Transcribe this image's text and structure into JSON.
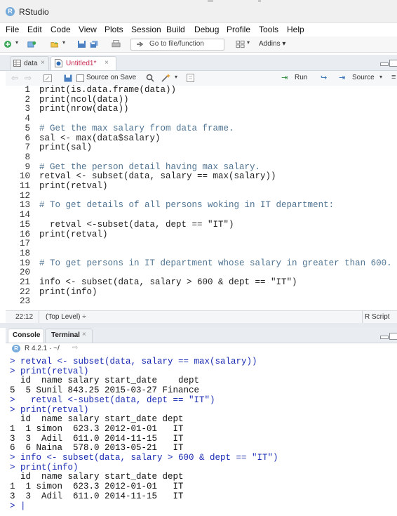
{
  "app": {
    "title": "RStudio",
    "icon_letter": "R"
  },
  "menu": [
    "File",
    "Edit",
    "Code",
    "View",
    "Plots",
    "Session",
    "Build",
    "Debug",
    "Profile",
    "Tools",
    "Help"
  ],
  "toolbar": {
    "goto_placeholder": "Go to file/function",
    "addins_label": "Addins"
  },
  "editor_tabs": [
    {
      "label": "data",
      "close": "×"
    },
    {
      "label": "Untitled1*",
      "close": "×"
    }
  ],
  "editor_toolbar": {
    "source_on_save": "Source on Save",
    "run_label": "Run",
    "source_label": "Source"
  },
  "code_lines": [
    {
      "n": "1",
      "text": "print(is.data.frame(data))",
      "kind": "code"
    },
    {
      "n": "2",
      "text": "print(ncol(data))",
      "kind": "code"
    },
    {
      "n": "3",
      "text": "print(nrow(data))",
      "kind": "code"
    },
    {
      "n": "4",
      "text": "",
      "kind": "code"
    },
    {
      "n": "5",
      "text": "# Get the max salary from data frame.",
      "kind": "comment"
    },
    {
      "n": "6",
      "text": "sal <- max(data$salary)",
      "kind": "code"
    },
    {
      "n": "7",
      "text": "print(sal)",
      "kind": "code"
    },
    {
      "n": "8",
      "text": "",
      "kind": "code"
    },
    {
      "n": "9",
      "text": "# Get the person detail having max salary.",
      "kind": "comment"
    },
    {
      "n": "10",
      "text": "retval <- subset(data, salary == max(salary))",
      "kind": "code"
    },
    {
      "n": "11",
      "text": "print(retval)",
      "kind": "code"
    },
    {
      "n": "12",
      "text": "",
      "kind": "code"
    },
    {
      "n": "13",
      "text": "# To get details of all persons woking in IT department:",
      "kind": "comment"
    },
    {
      "n": "14",
      "text": "",
      "kind": "code"
    },
    {
      "n": "15",
      "text": "  retval <-subset(data, dept == \"IT\")",
      "kind": "code"
    },
    {
      "n": "16",
      "text": "print(retval)",
      "kind": "code"
    },
    {
      "n": "17",
      "text": "",
      "kind": "code"
    },
    {
      "n": "18",
      "text": "",
      "kind": "code"
    },
    {
      "n": "19",
      "text": "# To get persons in IT department whose salary in greater than 600.",
      "kind": "comment"
    },
    {
      "n": "20",
      "text": "",
      "kind": "code"
    },
    {
      "n": "21",
      "text": "info <- subset(data, salary > 600 & dept == \"IT\")",
      "kind": "code"
    },
    {
      "n": "22",
      "text": "print(info)",
      "kind": "code"
    },
    {
      "n": "23",
      "text": "",
      "kind": "code"
    }
  ],
  "status": {
    "position": "22:12",
    "scope": "(Top Level) ÷",
    "filetype": "R Script"
  },
  "console_tabs": [
    {
      "label": "Console",
      "close": ""
    },
    {
      "label": "Terminal",
      "close": "×"
    }
  ],
  "console_header": {
    "version": "R 4.2.1 · ~/"
  },
  "console_lines": [
    {
      "text": "> retval <- subset(data, salary == max(salary))",
      "kind": "in"
    },
    {
      "text": "> print(retval)",
      "kind": "in"
    },
    {
      "text": "  id  name salary start_date    dept",
      "kind": "out"
    },
    {
      "text": "5  5 Sunil 843.25 2015-03-27 Finance",
      "kind": "out"
    },
    {
      "text": ">   retval <-subset(data, dept == \"IT\")",
      "kind": "in"
    },
    {
      "text": "> print(retval)",
      "kind": "in"
    },
    {
      "text": "  id  name salary start_date dept",
      "kind": "out"
    },
    {
      "text": "1  1 simon  623.3 2012-01-01   IT",
      "kind": "out"
    },
    {
      "text": "3  3  Adil  611.0 2014-11-15   IT",
      "kind": "out"
    },
    {
      "text": "6  6 Naina  578.0 2013-05-21   IT",
      "kind": "out"
    },
    {
      "text": "> info <- subset(data, salary > 600 & dept == \"IT\")",
      "kind": "in"
    },
    {
      "text": "> print(info)",
      "kind": "in"
    },
    {
      "text": "  id  name salary start_date dept",
      "kind": "out"
    },
    {
      "text": "1  1 simon  623.3 2012-01-01   IT",
      "kind": "out"
    },
    {
      "text": "3  3  Adil  611.0 2014-11-15   IT",
      "kind": "out"
    },
    {
      "text": "> |",
      "kind": "in"
    }
  ],
  "colors": {
    "prompt_blue": "#1a2bb3",
    "comment": "#4f7391",
    "r_blue": "#75aadb"
  }
}
